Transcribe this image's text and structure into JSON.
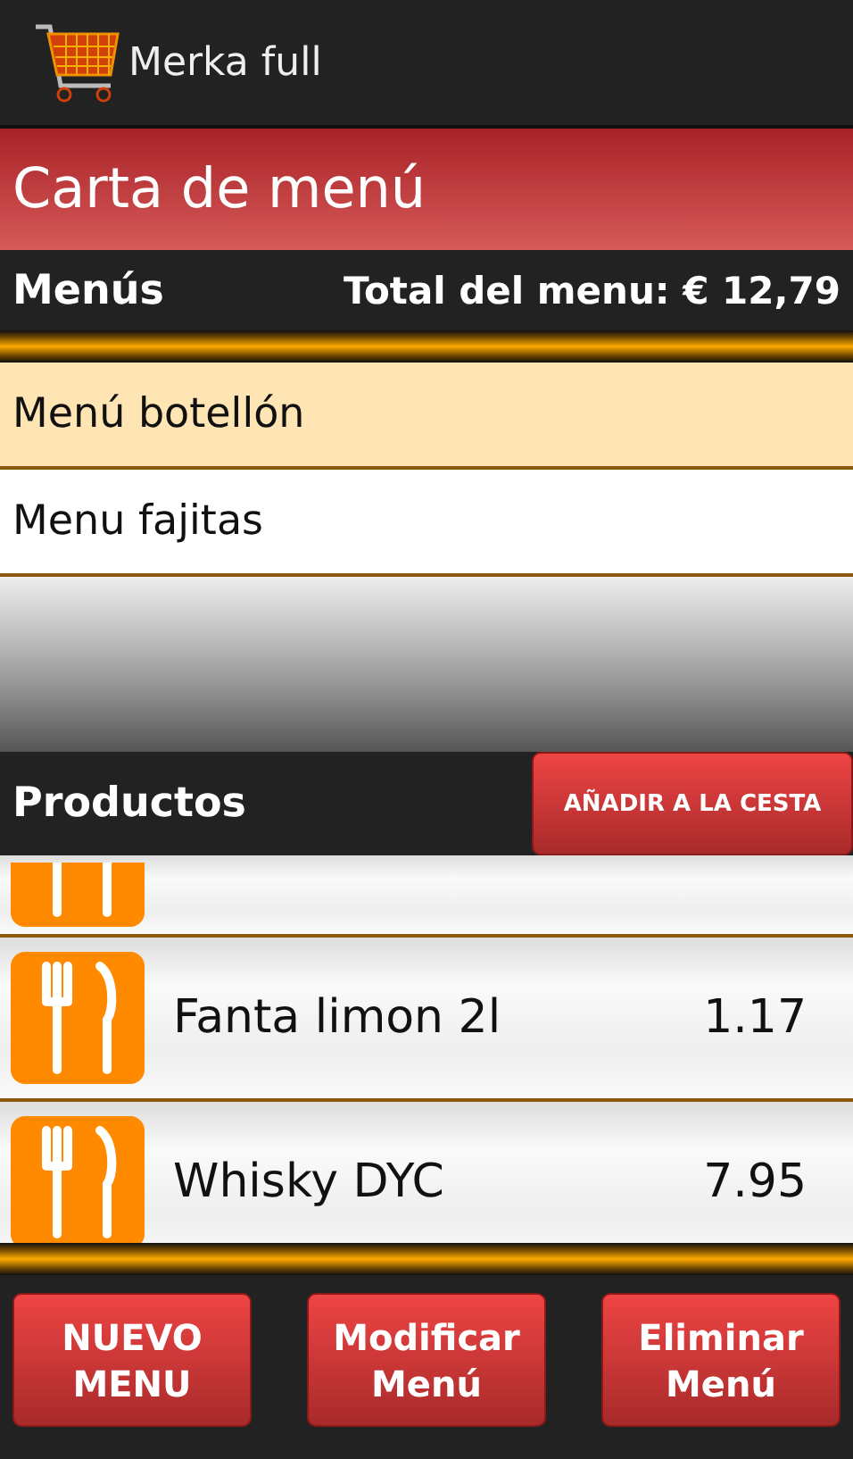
{
  "app_bar": {
    "title": "Merka full"
  },
  "screen_title": "Carta de menú",
  "menus_header": {
    "label": "Menús",
    "total": "Total del menu: € 12,79"
  },
  "menus": [
    {
      "name": "Menú botellón",
      "selected": true
    },
    {
      "name": "Menu fajitas",
      "selected": false
    }
  ],
  "products_header": {
    "label": "Productos",
    "button": "AÑADIR A LA CESTA"
  },
  "products": [
    {
      "kind": "partial"
    },
    {
      "kind": "full",
      "name": "Fanta limon 2l",
      "price": "1.17"
    },
    {
      "kind": "full",
      "name": "Whisky DYC",
      "price": "7.95"
    }
  ],
  "buttons": [
    [
      "NUEVO",
      "MENU"
    ],
    [
      "Modificar",
      "Menú"
    ],
    [
      "Eliminar",
      "Menú"
    ]
  ]
}
